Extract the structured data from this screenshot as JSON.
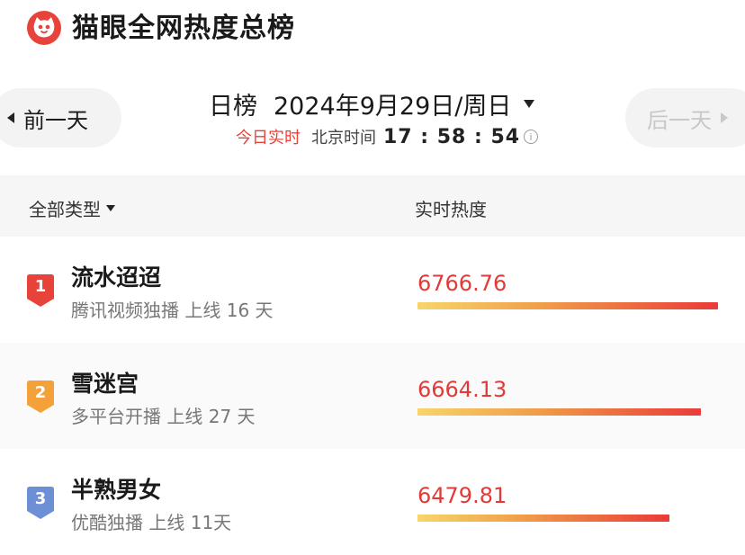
{
  "header": {
    "title": "猫眼全网热度总榜",
    "logo_icon": "cat-face-icon",
    "brand_color": "#e8433a"
  },
  "date_nav": {
    "prev_label": "前一天",
    "next_label": "后一天",
    "chart_type": "日榜",
    "date": "2024年9月29日/周日",
    "realtime_label": "今日实时",
    "timezone_label": "北京时间",
    "clock": "17 : 58 : 54"
  },
  "table_header": {
    "filter_label": "全部类型",
    "heat_label": "实时热度"
  },
  "rankings": [
    {
      "rank": "1",
      "title": "流水迢迢",
      "meta": "腾讯视频独播 上线 16 天",
      "heat": "6766.76",
      "heat_value": 6766.76,
      "badge_color": "#e8433a"
    },
    {
      "rank": "2",
      "title": "雪迷宫",
      "meta": "多平台开播 上线 27 天",
      "heat": "6664.13",
      "heat_value": 6664.13,
      "badge_color": "#f5a13a"
    },
    {
      "rank": "3",
      "title": "半熟男女",
      "meta": "优酷独播 上线 11天",
      "heat": "6479.81",
      "heat_value": 6479.81,
      "badge_color": "#6d8fd6"
    }
  ]
}
